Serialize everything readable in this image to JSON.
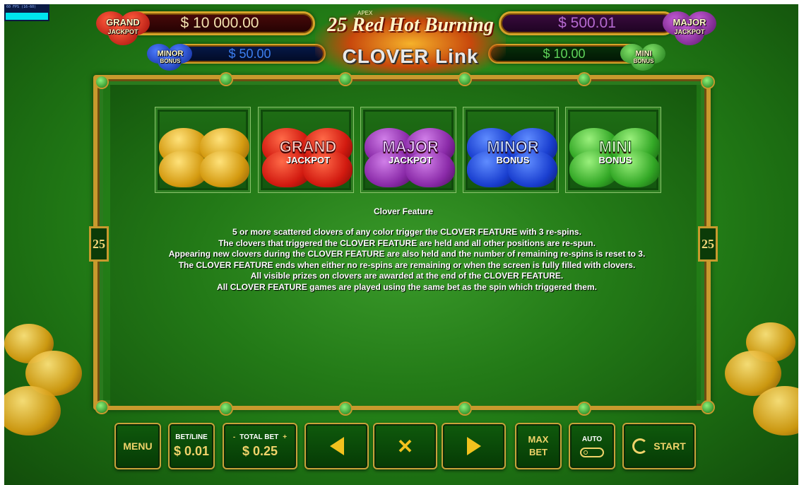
{
  "overlay": {
    "fps_text": "60 FPS (16-60)"
  },
  "header": {
    "grand": {
      "label_top": "GRAND",
      "label_bottom": "JACKPOT",
      "amount": "$ 10 000.00"
    },
    "major": {
      "label_top": "MAJOR",
      "label_bottom": "JACKPOT",
      "amount": "$ 500.01"
    },
    "minor": {
      "label_top": "MINOR",
      "label_bottom": "BONUS",
      "amount": "$ 50.00"
    },
    "mini": {
      "label_top": "MINI",
      "label_bottom": "BONUS",
      "amount": "$ 10.00"
    },
    "logo": {
      "apex": "APEX",
      "title": "25 Red Hot Burning",
      "subtitle": "CLOVER Link"
    }
  },
  "paytable": {
    "edge_number": "25",
    "symbols": [
      {
        "name": "",
        "sub": ""
      },
      {
        "name": "GRAND",
        "sub": "JACKPOT"
      },
      {
        "name": "MAJOR",
        "sub": "JACKPOT"
      },
      {
        "name": "MINOR",
        "sub": "BONUS"
      },
      {
        "name": "MINI",
        "sub": "BONUS"
      }
    ],
    "feature_title": "Clover Feature",
    "feature_lines": [
      "5 or more scattered clovers of any color trigger the CLOVER FEATURE with 3 re-spins.",
      "The clovers that triggered the CLOVER FEATURE are held and all other positions are re-spun.",
      "Appearing new clovers during the CLOVER FEATURE are also held and the number of remaining re-spins is reset to 3.",
      "The CLOVER FEATURE ends when either no re-spins are remaining or when the screen is fully filled with clovers.",
      "All visible prizes on clovers are awarded at the end of the CLOVER FEATURE.",
      "All CLOVER FEATURE games are played using the same bet as the spin which triggered them."
    ]
  },
  "controls": {
    "menu": "MENU",
    "bet_line_label": "BET/LINE",
    "bet_line_value": "$ 0.01",
    "total_bet_minus": "-",
    "total_bet_label": "TOTAL BET",
    "total_bet_plus": "+",
    "total_bet_value": "$ 0.25",
    "max_bet_line1": "MAX",
    "max_bet_line2": "BET",
    "auto_label": "AUTO",
    "start": "START"
  },
  "colors": {
    "background_green": "#2a8f1c",
    "gold_border": "#c89a2d",
    "button_text": "#f0d36a",
    "arrow_yellow": "#f2c21e"
  }
}
